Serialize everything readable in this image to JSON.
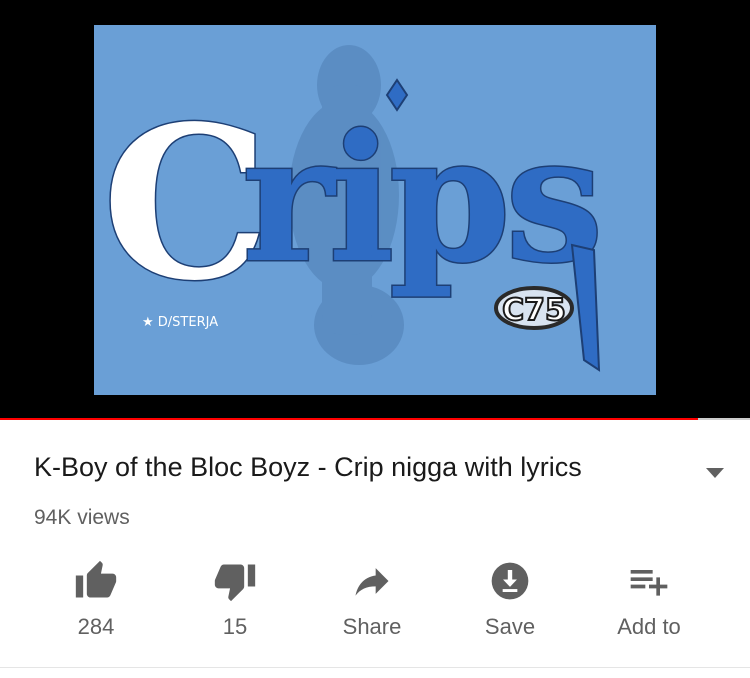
{
  "video": {
    "title": "K-Boy of the Bloc Boyz - Crip nigga with lyrics",
    "views": "94K views",
    "progress_fraction": 0.93
  },
  "thumbnail": {
    "logo_text": "Crips",
    "badge_text": "C75",
    "credit_text": "★ D/STERJA",
    "colors": {
      "background": "#6a9fd6",
      "letters": "#2f6cc4",
      "shadow": "#4f7fb4"
    }
  },
  "actions": [
    {
      "id": "like",
      "label": "284",
      "icon": "thumbs-up-icon"
    },
    {
      "id": "dislike",
      "label": "15",
      "icon": "thumbs-down-icon"
    },
    {
      "id": "share",
      "label": "Share",
      "icon": "share-icon"
    },
    {
      "id": "save",
      "label": "Save",
      "icon": "download-icon"
    },
    {
      "id": "add",
      "label": "Add to",
      "icon": "playlist-add-icon"
    }
  ],
  "colors": {
    "accent": "#ff0000",
    "icon": "#606060",
    "text": "#1a1a1a"
  }
}
